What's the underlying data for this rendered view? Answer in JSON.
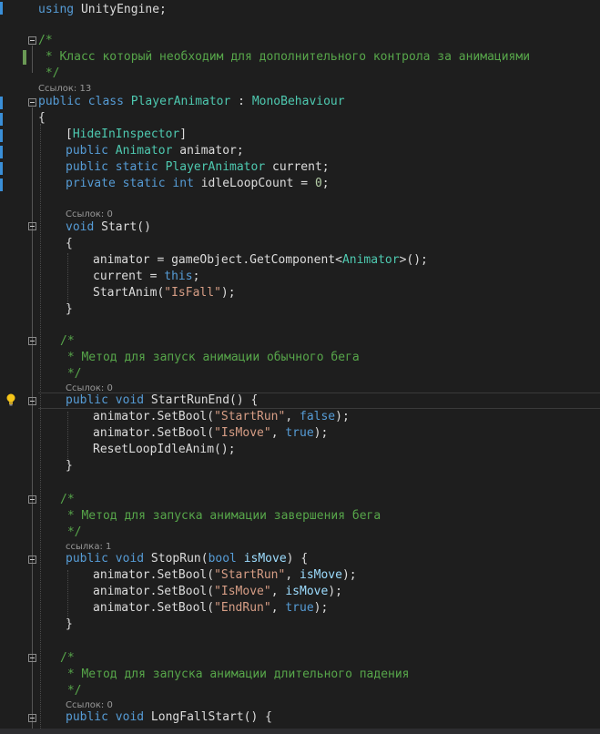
{
  "editor": {
    "using_kw": "using",
    "using_ns": "UnityEngine;",
    "comment1": {
      "open": "/*",
      "body": " * Класс который необходим для дополнительного контрола за анимациями",
      "close": " */"
    },
    "lens_class": "Ссылок: 13",
    "class_decl": {
      "public": "public",
      "class": "class",
      "name": "PlayerAnimator",
      "colon": " : ",
      "base": "MonoBehaviour"
    },
    "brace_open": "{",
    "brace_close": "}",
    "attr": {
      "open": "[",
      "name": "HideInInspector",
      "close": "]"
    },
    "field1": {
      "public": "public",
      "type": "Animator",
      "name": " animator;"
    },
    "field2": {
      "public": "public",
      "static": "static",
      "type": "PlayerAnimator",
      "name": " current;"
    },
    "field3": {
      "private": "private",
      "static": "static",
      "int": "int",
      "name": " idleLoopCount = ",
      "value": "0",
      "end": ";"
    },
    "start": {
      "lens": "Ссылок: 0",
      "void": "void",
      "name": " Start()",
      "l1_a": "animator = gameObject.GetComponent<",
      "l1_t": "Animator",
      "l1_b": ">();",
      "l2_a": "current = ",
      "l2_kw": "this",
      "l2_b": ";",
      "l3_a": "StartAnim(",
      "l3_s": "\"IsFall\"",
      "l3_b": ");"
    },
    "comment2": {
      "open": "/*",
      "body": " * Метод для запуск анимации обычного бега",
      "close": " */"
    },
    "startRunEnd": {
      "lens": "Ссылок: 0",
      "public": "public",
      "void": "void",
      "name": " StartRunEnd() {",
      "l1_a": "animator.SetBool(",
      "l1_s": "\"StartRun\"",
      "l1_c": ", ",
      "l1_kw": "false",
      "l1_b": ");",
      "l2_a": "animator.SetBool(",
      "l2_s": "\"IsMove\"",
      "l2_c": ", ",
      "l2_kw": "true",
      "l2_b": ");",
      "l3": "ResetLoopIdleAnim();"
    },
    "comment3": {
      "open": "/*",
      "body": " * Метод для запуска анимации завершения бега",
      "close": " */"
    },
    "stopRun": {
      "lens": "ссылка: 1",
      "public": "public",
      "void": "void",
      "name": " StopRun(",
      "bool": "bool",
      "param": " isMove",
      "tail": ") {",
      "l1_a": "animator.SetBool(",
      "l1_s": "\"StartRun\"",
      "l1_c": ", ",
      "l1_p": "isMove",
      "l1_b": ");",
      "l2_a": "animator.SetBool(",
      "l2_s": "\"IsMove\"",
      "l2_c": ", ",
      "l2_p": "isMove",
      "l2_b": ");",
      "l3_a": "animator.SetBool(",
      "l3_s": "\"EndRun\"",
      "l3_c": ", ",
      "l3_kw": "true",
      "l3_b": ");"
    },
    "comment4": {
      "open": "/*",
      "body": " * Метод для запуска анимации длительного падения",
      "close": " */"
    },
    "longFall": {
      "lens": "Ссылок: 0",
      "public": "public",
      "void": "void",
      "name": " LongFallStart() {"
    }
  },
  "colors": {
    "background": "#1e1e1e",
    "keyword": "#569cd6",
    "type": "#4ec9b0",
    "comment": "#57a64a",
    "string": "#d69d85",
    "number": "#b5cea8",
    "parameter": "#9cdcfe"
  },
  "icons": {
    "lightbulb": "lightbulb-icon",
    "fold": "collapse-icon"
  }
}
